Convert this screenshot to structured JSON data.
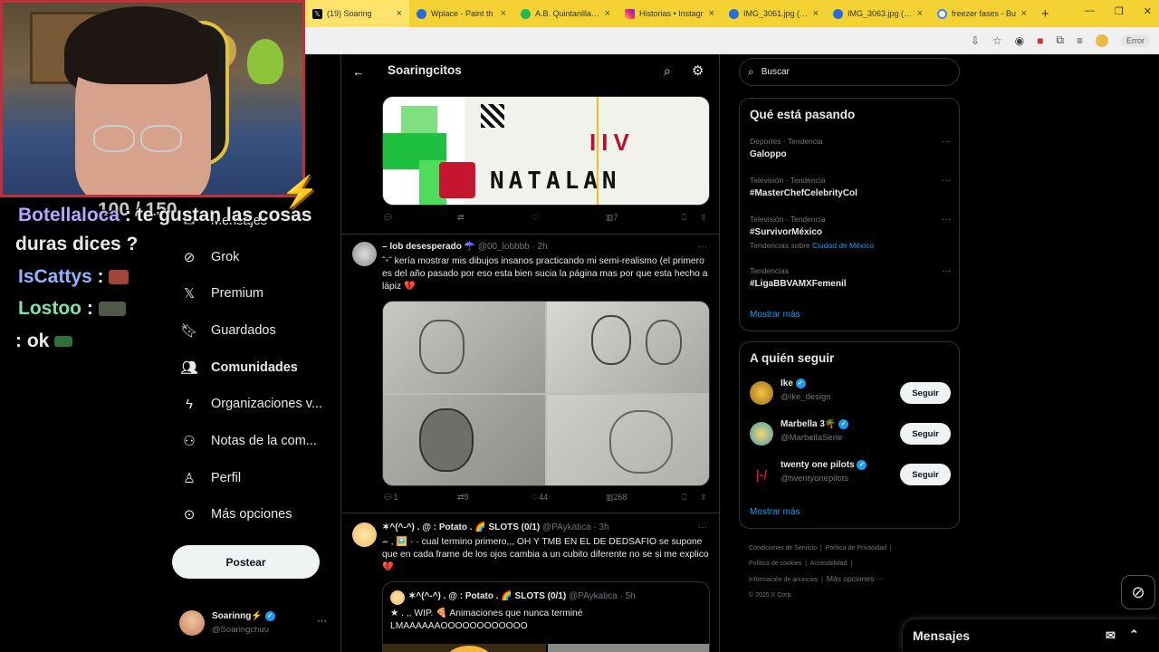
{
  "browser": {
    "tabs": [
      {
        "label": "(19) Soaring",
        "favicon": "x-icon",
        "color": "#000000"
      },
      {
        "label": "Wplace - Paint th",
        "favicon": "globe-icon",
        "color": "#2a6bd6"
      },
      {
        "label": "A.B. Quintanilla III",
        "favicon": "spotify-icon",
        "color": "#1db954"
      },
      {
        "label": "Historias • Instagr",
        "favicon": "instagram-icon",
        "color": "#d6249f"
      },
      {
        "label": "IMG_3061.jpg (49",
        "favicon": "globe-icon",
        "color": "#2a6bd6"
      },
      {
        "label": "IMG_3063.jpg (49",
        "favicon": "globe-icon",
        "color": "#2a6bd6"
      },
      {
        "label": "freezer fases - Bu",
        "favicon": "google-icon",
        "color": "#4285f4"
      }
    ],
    "error_label": "Error"
  },
  "stream": {
    "viewers": "100 / 150",
    "chat": [
      {
        "user": "Botellaloca",
        "user_color": "#b9a3ff",
        "text": "te gustan las cosas",
        "text2": "duras dices ?"
      },
      {
        "user": "IsCattys",
        "user_color": "#8fb3ff",
        "text": ""
      },
      {
        "user": "Lostoo",
        "user_color": "#7fe3b0",
        "text": ""
      },
      {
        "user": "",
        "text": ": ok"
      }
    ]
  },
  "nav": {
    "items": [
      {
        "label": "Mensajes",
        "icon": "mail-icon"
      },
      {
        "label": "Grok",
        "icon": "grok-icon"
      },
      {
        "label": "Premium",
        "icon": "x-logo-icon"
      },
      {
        "label": "Guardados",
        "icon": "bookmark-icon"
      },
      {
        "label": "Comunidades",
        "icon": "communities-icon"
      },
      {
        "label": "Organizaciones v...",
        "icon": "lightning-icon"
      },
      {
        "label": "Notas de la com...",
        "icon": "community-notes-icon"
      },
      {
        "label": "Perfil",
        "icon": "person-icon"
      },
      {
        "label": "Más opciones",
        "icon": "more-circle-icon"
      }
    ],
    "post_label": "Postear",
    "account": {
      "name": "Soarinng⚡",
      "handle": "@Soaringchuu"
    }
  },
  "feed": {
    "title": "Soaringcitos",
    "post0": {
      "replies": "",
      "reposts": "",
      "likes": "",
      "views": "7",
      "image_text": "NATALAN"
    },
    "post1": {
      "name": "– lob desesperado ☂️",
      "handle": "@00_lobbbb",
      "time": "2h",
      "text": "ˆᵕˆ   kería mostrar mis dibujos insanos practicando mi semi-realismo (el primero es del año pasado por eso esta bien sucia la página mas por que esta hecho a lápiz 💔",
      "replies": "1",
      "reposts": "9",
      "likes": "44",
      "views": "268"
    },
    "post2": {
      "name": "✶^(^-^) . @ : Potato . 🌈 SLOTS (0/1)",
      "handle": "@PAykatica",
      "time": "3h",
      "text": "⌢ , 🖼️ ·  ·  cual termino primero,,, OH Y TMB EN EL DE DEDSAFIO se supone que en cada frame de los ojos cambia a un cubito diferente no se si me explico 💔",
      "quote": {
        "name": "✶^(^-^) . @ : Potato . 🌈 SLOTS (0/1)",
        "handle": "@PAykatica",
        "time": "5h",
        "text": "★ . ,, WIP. 🍕 Animaciones que nunca terminé LMAAAAAAOOOOOOOOOOOO"
      }
    }
  },
  "sidebar": {
    "search_placeholder": "Buscar",
    "trends_title": "Qué está pasando",
    "trends": [
      {
        "category": "Deportes · Tendencia",
        "name": "Galoppo",
        "sub": ""
      },
      {
        "category": "Televisión · Tendencia",
        "name": "#MasterChefCelebrityCol",
        "sub": ""
      },
      {
        "category": "Televisión · Tendencia",
        "name": "#SurvivorMéxico",
        "sub": "Tendencias sobre",
        "sub_link": "Ciudad de México"
      },
      {
        "category": "Tendencias",
        "name": "#LigaBBVAMXFemenil",
        "sub": ""
      }
    ],
    "show_more": "Mostrar más",
    "who_title": "A quién seguir",
    "who": [
      {
        "name": "Ike",
        "handle": "@Ike_design",
        "button": "Seguir"
      },
      {
        "name": "Marbella 3🌴",
        "handle": "@MarbellaSerle",
        "button": "Seguir"
      },
      {
        "name": "twenty one pilots",
        "handle": "@twentyonepilots",
        "button": "Seguir"
      }
    ],
    "footer": {
      "l1a": "Condiciones de Servicio",
      "l1b": "Política de Privacidad",
      "l2a": "Política de cookies",
      "l2b": "Accesibilidad",
      "l3a": "Información de anuncios",
      "l3b": "Más opciones ···",
      "copyright": "© 2025 X Corp."
    },
    "messages_label": "Mensajes"
  }
}
